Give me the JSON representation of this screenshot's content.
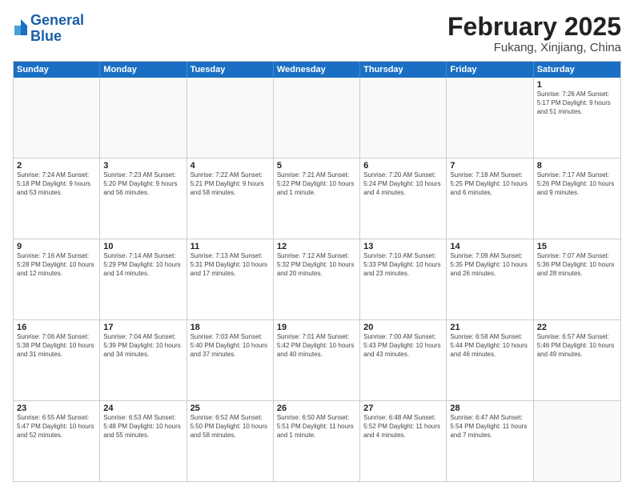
{
  "header": {
    "logo_line1": "General",
    "logo_line2": "Blue",
    "month_title": "February 2025",
    "location": "Fukang, Xinjiang, China"
  },
  "days_of_week": [
    "Sunday",
    "Monday",
    "Tuesday",
    "Wednesday",
    "Thursday",
    "Friday",
    "Saturday"
  ],
  "weeks": [
    [
      {
        "day": "",
        "info": "",
        "empty": true
      },
      {
        "day": "",
        "info": "",
        "empty": true
      },
      {
        "day": "",
        "info": "",
        "empty": true
      },
      {
        "day": "",
        "info": "",
        "empty": true
      },
      {
        "day": "",
        "info": "",
        "empty": true
      },
      {
        "day": "",
        "info": "",
        "empty": true
      },
      {
        "day": "1",
        "info": "Sunrise: 7:26 AM\nSunset: 5:17 PM\nDaylight: 9 hours and 51 minutes.",
        "empty": false
      }
    ],
    [
      {
        "day": "2",
        "info": "Sunrise: 7:24 AM\nSunset: 5:18 PM\nDaylight: 9 hours and 53 minutes.",
        "empty": false
      },
      {
        "day": "3",
        "info": "Sunrise: 7:23 AM\nSunset: 5:20 PM\nDaylight: 9 hours and 56 minutes.",
        "empty": false
      },
      {
        "day": "4",
        "info": "Sunrise: 7:22 AM\nSunset: 5:21 PM\nDaylight: 9 hours and 58 minutes.",
        "empty": false
      },
      {
        "day": "5",
        "info": "Sunrise: 7:21 AM\nSunset: 5:22 PM\nDaylight: 10 hours and 1 minute.",
        "empty": false
      },
      {
        "day": "6",
        "info": "Sunrise: 7:20 AM\nSunset: 5:24 PM\nDaylight: 10 hours and 4 minutes.",
        "empty": false
      },
      {
        "day": "7",
        "info": "Sunrise: 7:18 AM\nSunset: 5:25 PM\nDaylight: 10 hours and 6 minutes.",
        "empty": false
      },
      {
        "day": "8",
        "info": "Sunrise: 7:17 AM\nSunset: 5:26 PM\nDaylight: 10 hours and 9 minutes.",
        "empty": false
      }
    ],
    [
      {
        "day": "9",
        "info": "Sunrise: 7:16 AM\nSunset: 5:28 PM\nDaylight: 10 hours and 12 minutes.",
        "empty": false
      },
      {
        "day": "10",
        "info": "Sunrise: 7:14 AM\nSunset: 5:29 PM\nDaylight: 10 hours and 14 minutes.",
        "empty": false
      },
      {
        "day": "11",
        "info": "Sunrise: 7:13 AM\nSunset: 5:31 PM\nDaylight: 10 hours and 17 minutes.",
        "empty": false
      },
      {
        "day": "12",
        "info": "Sunrise: 7:12 AM\nSunset: 5:32 PM\nDaylight: 10 hours and 20 minutes.",
        "empty": false
      },
      {
        "day": "13",
        "info": "Sunrise: 7:10 AM\nSunset: 5:33 PM\nDaylight: 10 hours and 23 minutes.",
        "empty": false
      },
      {
        "day": "14",
        "info": "Sunrise: 7:09 AM\nSunset: 5:35 PM\nDaylight: 10 hours and 26 minutes.",
        "empty": false
      },
      {
        "day": "15",
        "info": "Sunrise: 7:07 AM\nSunset: 5:36 PM\nDaylight: 10 hours and 28 minutes.",
        "empty": false
      }
    ],
    [
      {
        "day": "16",
        "info": "Sunrise: 7:06 AM\nSunset: 5:38 PM\nDaylight: 10 hours and 31 minutes.",
        "empty": false
      },
      {
        "day": "17",
        "info": "Sunrise: 7:04 AM\nSunset: 5:39 PM\nDaylight: 10 hours and 34 minutes.",
        "empty": false
      },
      {
        "day": "18",
        "info": "Sunrise: 7:03 AM\nSunset: 5:40 PM\nDaylight: 10 hours and 37 minutes.",
        "empty": false
      },
      {
        "day": "19",
        "info": "Sunrise: 7:01 AM\nSunset: 5:42 PM\nDaylight: 10 hours and 40 minutes.",
        "empty": false
      },
      {
        "day": "20",
        "info": "Sunrise: 7:00 AM\nSunset: 5:43 PM\nDaylight: 10 hours and 43 minutes.",
        "empty": false
      },
      {
        "day": "21",
        "info": "Sunrise: 6:58 AM\nSunset: 5:44 PM\nDaylight: 10 hours and 46 minutes.",
        "empty": false
      },
      {
        "day": "22",
        "info": "Sunrise: 6:57 AM\nSunset: 5:46 PM\nDaylight: 10 hours and 49 minutes.",
        "empty": false
      }
    ],
    [
      {
        "day": "23",
        "info": "Sunrise: 6:55 AM\nSunset: 5:47 PM\nDaylight: 10 hours and 52 minutes.",
        "empty": false
      },
      {
        "day": "24",
        "info": "Sunrise: 6:53 AM\nSunset: 5:48 PM\nDaylight: 10 hours and 55 minutes.",
        "empty": false
      },
      {
        "day": "25",
        "info": "Sunrise: 6:52 AM\nSunset: 5:50 PM\nDaylight: 10 hours and 58 minutes.",
        "empty": false
      },
      {
        "day": "26",
        "info": "Sunrise: 6:50 AM\nSunset: 5:51 PM\nDaylight: 11 hours and 1 minute.",
        "empty": false
      },
      {
        "day": "27",
        "info": "Sunrise: 6:48 AM\nSunset: 5:52 PM\nDaylight: 11 hours and 4 minutes.",
        "empty": false
      },
      {
        "day": "28",
        "info": "Sunrise: 6:47 AM\nSunset: 5:54 PM\nDaylight: 11 hours and 7 minutes.",
        "empty": false
      },
      {
        "day": "",
        "info": "",
        "empty": true
      }
    ]
  ]
}
